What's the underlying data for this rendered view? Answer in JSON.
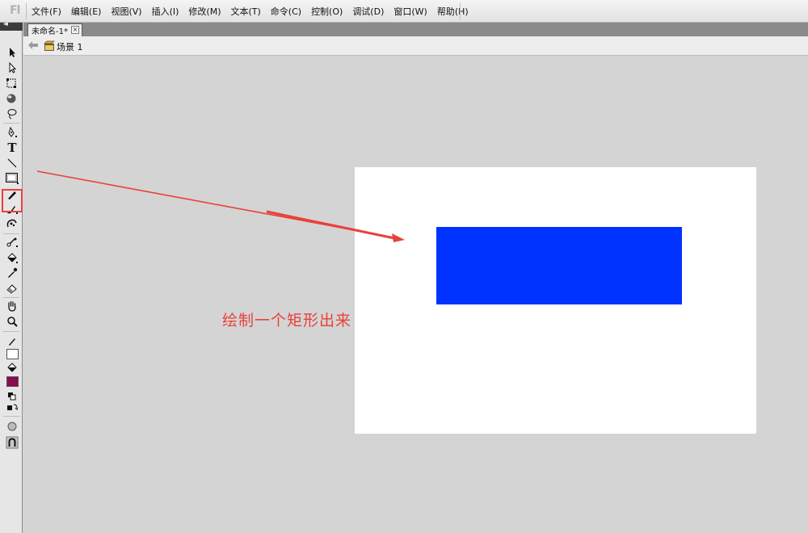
{
  "app": {
    "logo": "Fl"
  },
  "menu": {
    "items": [
      "文件(F)",
      "编辑(E)",
      "视图(V)",
      "插入(I)",
      "修改(M)",
      "文本(T)",
      "命令(C)",
      "控制(O)",
      "调试(D)",
      "窗口(W)",
      "帮助(H)"
    ]
  },
  "toolbox": {
    "collapse_glyph": "◂◂",
    "text_tool_glyph": "T",
    "selected_tool": "rectangle-tool"
  },
  "document": {
    "tab_label": "未命名-1*",
    "close_glyph": "×",
    "scene_label": "场景 1"
  },
  "stage": {
    "background": "#ffffff",
    "shape_fill": "#0033ff"
  },
  "colors": {
    "stroke_swatch": "#ffffff",
    "fill_swatch": "#8b0a50",
    "annotation": "#e8423a"
  },
  "annotation": {
    "text": "绘制一个矩形出来"
  }
}
